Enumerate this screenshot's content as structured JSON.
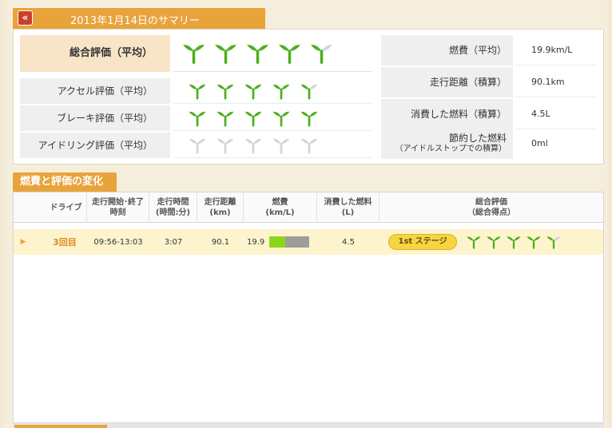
{
  "summary": {
    "title": "2013年1月14日のサマリー",
    "back_icon": "double-left-chevron-icon",
    "evaluations": [
      {
        "label": "総合評価（平均）",
        "green": 4,
        "partial": 1,
        "gray": 0
      },
      {
        "label": "アクセル評価（平均）",
        "green": 4,
        "partial": 1,
        "gray": 0
      },
      {
        "label": "ブレーキ評価（平均）",
        "green": 5,
        "partial": 0,
        "gray": 0
      },
      {
        "label": "アイドリング評価（平均）",
        "green": 0,
        "partial": 0,
        "gray": 5
      }
    ],
    "stats": [
      {
        "label": "燃費（平均）",
        "value": "19.9km/L"
      },
      {
        "label": "走行距離（積算）",
        "value": "90.1km"
      },
      {
        "label": "消費した燃料（積算）",
        "value": "4.5L"
      },
      {
        "label": "節約した燃料",
        "label2": "（アイドルストップでの積算）",
        "value": "0ml"
      }
    ]
  },
  "changes": {
    "title": "燃費と評価の変化",
    "headers": {
      "drive": "ドライブ",
      "start_end_1": "走行開始･終了",
      "start_end_2": "時刻",
      "time_1": "走行時間",
      "time_2": "(時間:分)",
      "distance_1": "走行距離",
      "distance_2": "(km)",
      "fuel_eff_1": "燃費",
      "fuel_eff_2": "(km/L)",
      "fuel_used_1": "消費した燃料",
      "fuel_used_2": "(L)",
      "overall_1": "総合評価",
      "overall_2": "（総合得点）"
    },
    "rows": [
      {
        "drive": "3回目",
        "start_end": "09:56-13:03",
        "time": "3:07",
        "distance": "90.1",
        "fuel_eff": "19.9",
        "fuel_eff_fraction": 0.4,
        "fuel_used": "4.5",
        "stage": "1st ステージ",
        "sprouts_green": 4,
        "sprouts_partial": 1
      }
    ]
  },
  "colors": {
    "accent": "#e8a33b",
    "sprout_green": "#4caf1f",
    "sprout_gray": "#d4d4d4",
    "row_highlight": "#fdf4cd",
    "bar_green": "#8cd61a"
  }
}
